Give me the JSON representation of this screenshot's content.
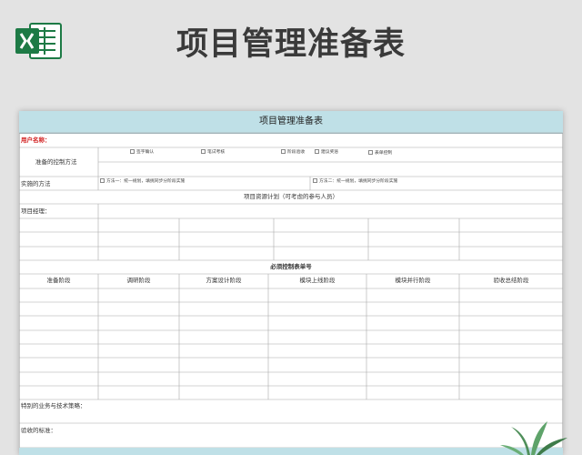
{
  "banner": {
    "icon": "excel-icon",
    "title": "项目管理准备表"
  },
  "sheet": {
    "title": "项目管理准备表",
    "user_label": "用户名称：",
    "control_method_label": "准备的控制方法",
    "checkboxes": [
      "签字确认",
      "笔试考核",
      "阶段验收",
      "建议奖惩",
      "表单控制"
    ],
    "implement_label": "实施的方法",
    "method1": "方法一：统一规划，填挑同步分阶段实施",
    "method2": "方法二：统一规划，填挑同步分阶段实施",
    "resource_plan_label": "项目资源计划（可考虑的参与人员）",
    "manager_label": "项目经理：",
    "required_control_label": "必须控制表单号",
    "stages": [
      "准备阶段",
      "调研阶段",
      "方案设计阶段",
      "模块上线阶段",
      "模块并行阶段",
      "验收总结阶段"
    ],
    "special_label": "特别的业务与技术策略：",
    "acceptance_label": "验收的标准："
  },
  "colors": {
    "header_fill": "#bfe0e7",
    "accent_red": "#d11b1b",
    "excel_green": "#1d7a45"
  },
  "decor": {
    "plant": "plant-decoration"
  }
}
